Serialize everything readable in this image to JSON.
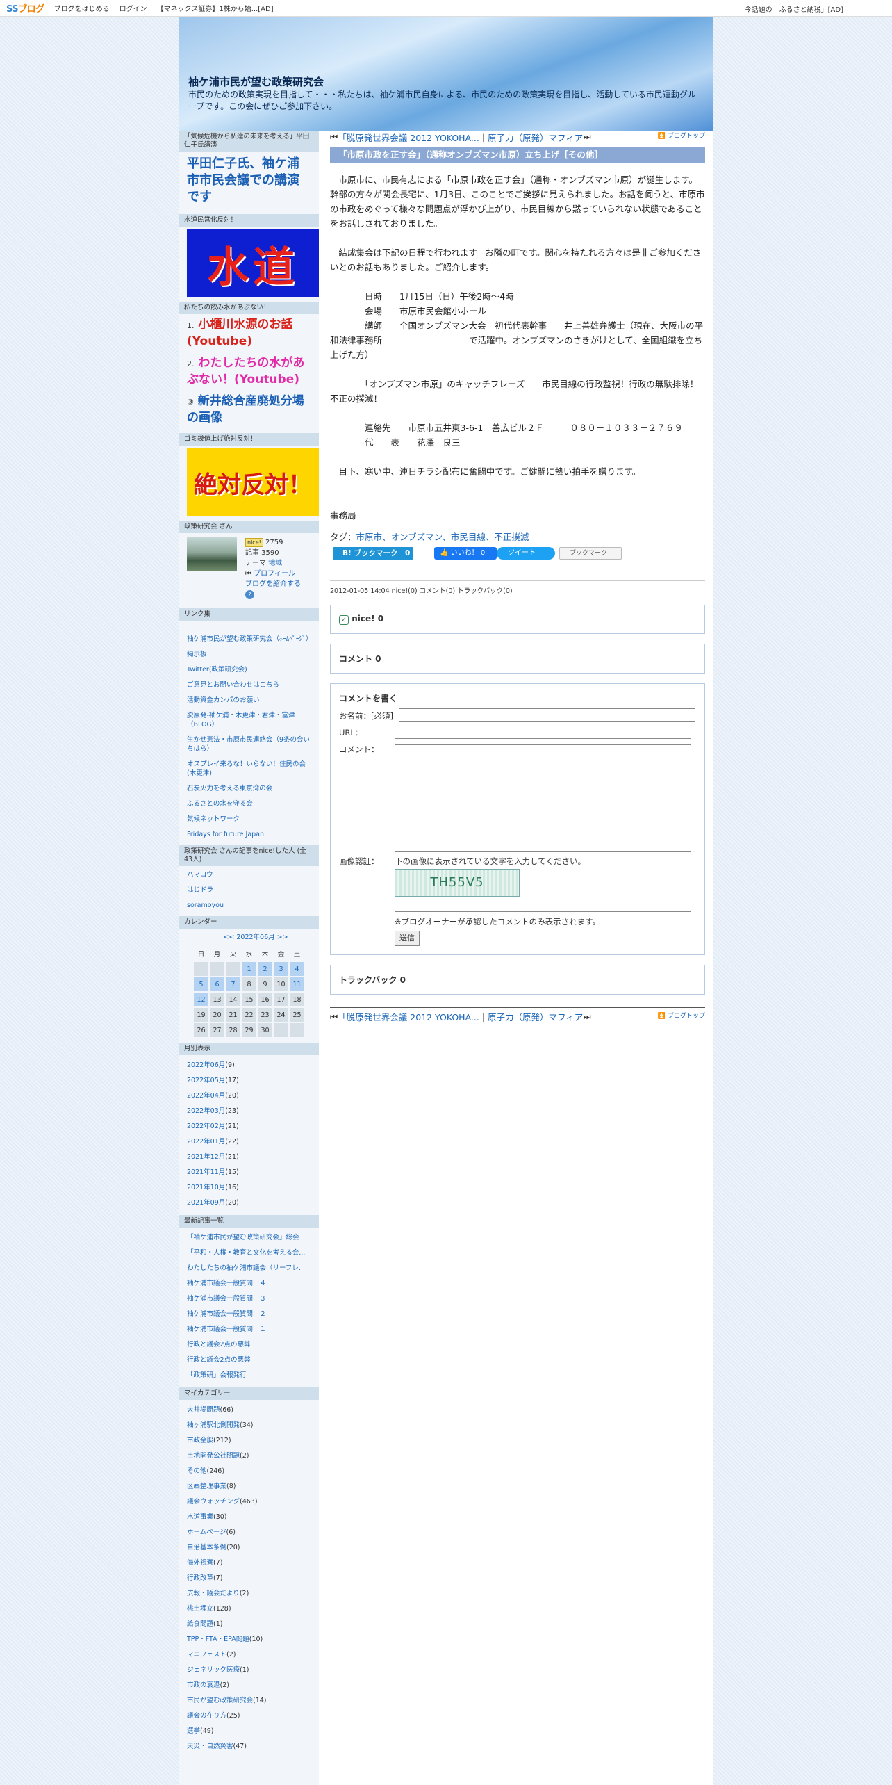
{
  "topbar": {
    "logo_prefix": "SS",
    "logo_suffix": "ブログ",
    "links": [
      "ブログをはじめる",
      "ログイン",
      "【マネックス証券】1株から始...[AD]"
    ],
    "right_ad": "今話題の「ふるさと納税」[AD]"
  },
  "header": {
    "title": "袖ケ浦市民が望む政策研究会",
    "description": "市民のための政策実現を目指して・・・私たちは、袖ケ浦市民自身による、市民のための政策実現を目指し、活動している市民運動グループです。この会にぜひご参加下さい。"
  },
  "sidebar": {
    "sec1_head": "「気候危機から私達の未来を考える」平田仁子氏講演",
    "sec1_link": "平田仁子氏、袖ケ浦市市民会議での講演です",
    "sec2_head": "水道民営化反対！",
    "suido_text": "水道",
    "sec3_head": "私たちの飲み水があぶない！",
    "water_links": [
      {
        "num": "1.",
        "label": "小櫃川水源のお話(Youtube)",
        "color": "#d8231b"
      },
      {
        "num": "2.",
        "label": "わたしたちの水があぶない！(Youtube)",
        "color": "#e22aa8"
      },
      {
        "num": "③",
        "label": "新井総合産廃処分場の画像",
        "color": "#1a5fb4"
      }
    ],
    "sec4_head": "ゴミ袋値上げ絶対反対！",
    "hantai_text": "絶対反対！",
    "profile_head": "政策研究会 さん",
    "profile": {
      "nice_badge": "nice!",
      "nice_count": "2759",
      "articles": "記事 3590",
      "theme_label": "テーマ",
      "theme_value": "地域",
      "profile_link": "プロフィール",
      "intro_link": "ブログを紹介する",
      "intro_icon": "?"
    },
    "links_head": "リンク集",
    "links": [
      "袖ケ浦市民が望む政策研究会（ﾎｰﾑﾍﾟｰｼﾞ）",
      "掲示板",
      "Twitter(政策研究会)",
      "ご意見とお問い合わせはこちら",
      "活動資金カンパのお願い",
      "脱原発-袖ケ浦・木更津・君津・富津（BLOG）",
      "生かせ憲法・市原市民連絡会（9条の会いちはら）",
      "オスプレイ来るな！いらない！住民の会(木更津)",
      "石炭火力を考える東京湾の会",
      "ふるさとの水を守る会",
      "気候ネットワーク",
      "Fridays for future Japan"
    ],
    "nice_head": "政策研究会 さんの記事をnice!した人 (全43人)",
    "nice_users": [
      "ハマコウ",
      "はじドラ",
      "soramoyou"
    ],
    "cal_head": "カレンダー",
    "calendar": {
      "prev": "<<",
      "month": "2022年06月",
      "next": ">>",
      "weekdays": [
        "日",
        "月",
        "火",
        "水",
        "木",
        "金",
        "土"
      ],
      "weeks": [
        [
          "",
          "",
          "",
          "1",
          "2",
          "3",
          "4"
        ],
        [
          "5",
          "6",
          "7",
          "8",
          "9",
          "10",
          "11"
        ],
        [
          "12",
          "13",
          "14",
          "15",
          "16",
          "17",
          "18"
        ],
        [
          "19",
          "20",
          "21",
          "22",
          "23",
          "24",
          "25"
        ],
        [
          "26",
          "27",
          "28",
          "29",
          "30",
          "",
          ""
        ]
      ],
      "linked": [
        "1",
        "2",
        "3",
        "4",
        "5",
        "6",
        "7",
        "11",
        "12"
      ]
    },
    "monthly_head": "月別表示",
    "monthly": [
      [
        "2022年06月",
        "(9)"
      ],
      [
        "2022年05月",
        "(17)"
      ],
      [
        "2022年04月",
        "(20)"
      ],
      [
        "2022年03月",
        "(23)"
      ],
      [
        "2022年02月",
        "(21)"
      ],
      [
        "2022年01月",
        "(22)"
      ],
      [
        "2021年12月",
        "(21)"
      ],
      [
        "2021年11月",
        "(15)"
      ],
      [
        "2021年10月",
        "(16)"
      ],
      [
        "2021年09月",
        "(20)"
      ]
    ],
    "recent_head": "最新記事一覧",
    "recent": [
      "「袖ケ浦市民が望む政策研究会」総会",
      "「平和・人権・教育と文化を考える会...",
      "わたしたちの袖ケ浦市議会（リーフレ...",
      "袖ケ浦市議会一般質問　４",
      "袖ケ浦市議会一般質問　３",
      "袖ケ浦市議会一般質問　２",
      "袖ケ浦市議会一般質問　１",
      "行政と議会2点の悪弊",
      "行政と議会2点の悪弊",
      "「政策研」会報発行"
    ],
    "cat_head": "マイカテゴリー",
    "categories": [
      [
        "大井場問題",
        "(66)"
      ],
      [
        "袖ヶ浦駅北側開発",
        "(34)"
      ],
      [
        "市政全般",
        "(212)"
      ],
      [
        "土地開発公社問題",
        "(2)"
      ],
      [
        "その他",
        "(246)"
      ],
      [
        "区画整理事業",
        "(8)"
      ],
      [
        "議会ウォッチング",
        "(463)"
      ],
      [
        "水道事業",
        "(30)"
      ],
      [
        "ホームページ",
        "(6)"
      ],
      [
        "自治基本条例",
        "(20)"
      ],
      [
        "海外視察",
        "(7)"
      ],
      [
        "行政改革",
        "(7)"
      ],
      [
        "広報・議会だより",
        "(2)"
      ],
      [
        "桃土埋立",
        "(128)"
      ],
      [
        "給食問題",
        "(1)"
      ],
      [
        "TPP・FTA・EPA問題",
        "(10)"
      ],
      [
        "マニフェスト",
        "(2)"
      ],
      [
        "ジェネリック医療",
        "(1)"
      ],
      [
        "市政の衰退",
        "(2)"
      ],
      [
        "市民が望む政策研究会",
        "(14)"
      ],
      [
        "議会の在り方",
        "(25)"
      ],
      [
        "選挙",
        "(49)"
      ],
      [
        "天災・自然災害",
        "(47)"
      ]
    ]
  },
  "article": {
    "nav_prev": "「脱原発世界会議 2012 YOKOHA...",
    "nav_sep": "|",
    "nav_next": "原子力（原発）マフィア",
    "nav_top": "ブログトップ",
    "title": "「市原市政を正す会」（通称オンブズマン市原）立ち上げ［その他］",
    "p1": "　市原市に、市民有志による「市原市政を正す会」（通称・オンブズマン市原）が誕生します。幹部の方々が関会長宅に、1月3日、このことでご挨拶に見えられました。お話を伺うと、市原市の市政をめぐって様々な問題点が浮かび上がり、市民目線から黙っていられない状態であることをお話しされておりました。",
    "p2": "　結成集会は下記の日程で行われます。お隣の町です。関心を持たれる方々は是非ご参加くださいとのお話もありました。ご紹介します。",
    "p3": "　　　　日時　　1月15日（日）午後2時～4時",
    "p4": "　　　　会場　　市原市民会館小ホール",
    "p5": "　　　　講師　　全国オンブズマン大会　初代代表幹事　　井上善雄弁護士（現在、大阪市の平和法律事務所　　　　　　　　　　で活躍中。オンブズマンのさきがけとして、全国組織を立ち上げた方）",
    "p6": "　　　　「オンブズマン市原」のキャッチフレーズ　　市民目線の行政監視！行政の無駄排除！不正の撲滅！",
    "p7": "　　　　連絡先　　市原市五井東3-6-1　善広ビル２Ｆ　　　０８０－１０３３－２７６９",
    "p8": "　　　　代　　表　　花澤　良三",
    "p9": "　目下、寒い中、連日チラシ配布に奮闘中です。ご健闘に熱い拍手を贈ります。",
    "p10": "事務局",
    "tag_label": "タグ：",
    "tags": "市原市、オンブズマン、市民目線、不正撲滅",
    "share": {
      "hatena": "B! ブックマーク　0",
      "like": "いいね！ 0",
      "tweet": "ツイート",
      "bookmark": "ブックマーク"
    },
    "meta": "2012-01-05 14:04  nice!(0)  コメント(0)  トラックバック(0)",
    "nice_title": "nice! 0",
    "comment_title": "コメント 0",
    "form": {
      "head": "コメントを書く",
      "name_label": "お名前：[必須]",
      "url_label": "URL：",
      "comment_label": "コメント：",
      "captcha_label": "画像認証：",
      "captcha_hint": "下の画像に表示されている文字を入力してください。",
      "captcha_text": "TH55V5",
      "note": "※ブログオーナーが承認したコメントのみ表示されます。",
      "submit": "送信"
    },
    "trackback_title": "トラックバック 0"
  }
}
